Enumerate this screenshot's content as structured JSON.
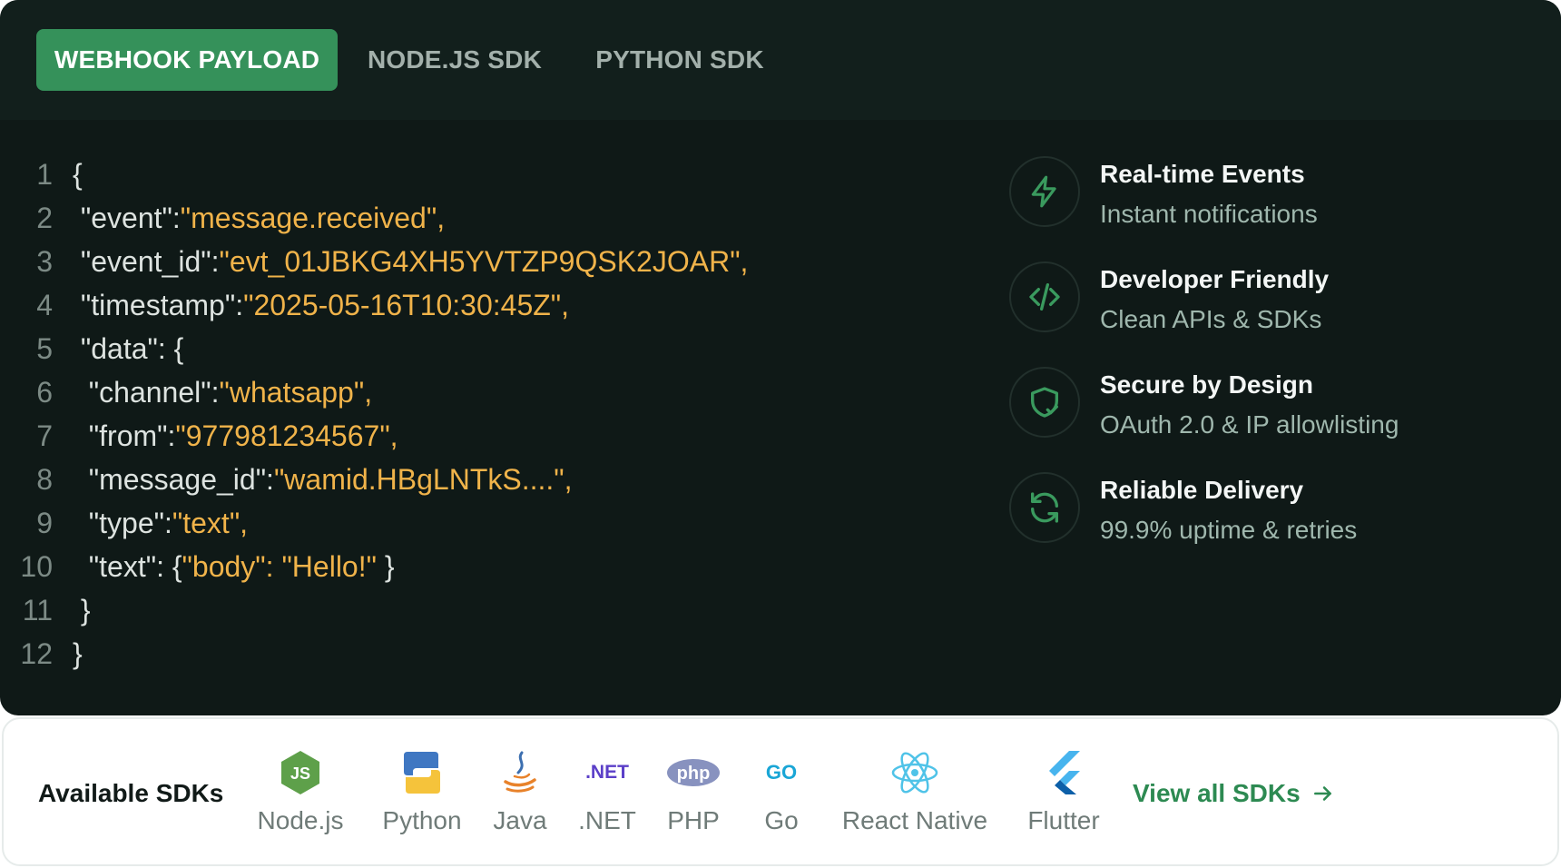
{
  "tabs": [
    {
      "label": "WEBHOOK PAYLOAD",
      "active": true
    },
    {
      "label": "NODE.JS SDK",
      "active": false
    },
    {
      "label": "PYTHON SDK",
      "active": false
    }
  ],
  "code_lines": [
    {
      "n": "1",
      "indent": "",
      "parts": [
        [
          "pun",
          "{"
        ]
      ]
    },
    {
      "n": "2",
      "indent": " ",
      "parts": [
        [
          "key",
          "\"event\":"
        ],
        [
          "str",
          "\"message.received\","
        ]
      ]
    },
    {
      "n": "3",
      "indent": " ",
      "parts": [
        [
          "key",
          "\"event_id\":"
        ],
        [
          "str",
          "\"evt_01JBKG4XH5YVTZP9QSK2JOAR\","
        ]
      ]
    },
    {
      "n": "4",
      "indent": " ",
      "parts": [
        [
          "key",
          "\"timestamp\":"
        ],
        [
          "str",
          "\"2025-05-16T10:30:45Z\","
        ]
      ]
    },
    {
      "n": "5",
      "indent": " ",
      "parts": [
        [
          "key",
          "\"data\": {"
        ]
      ]
    },
    {
      "n": "6",
      "indent": "  ",
      "parts": [
        [
          "key",
          "\"channel\":"
        ],
        [
          "str",
          "\"whatsapp\","
        ]
      ]
    },
    {
      "n": "7",
      "indent": "  ",
      "parts": [
        [
          "key",
          "\"from\":"
        ],
        [
          "str",
          "\"977981234567\","
        ]
      ]
    },
    {
      "n": "8",
      "indent": "  ",
      "parts": [
        [
          "key",
          "\"message_id\":"
        ],
        [
          "str",
          "\"wamid.HBgLNTkS....\","
        ]
      ]
    },
    {
      "n": "9",
      "indent": "  ",
      "parts": [
        [
          "key",
          "\"type\":"
        ],
        [
          "str",
          "\"text\","
        ]
      ]
    },
    {
      "n": "10",
      "indent": "  ",
      "parts": [
        [
          "key",
          "\"text\": {"
        ],
        [
          "str",
          "\"body\": \"Hello!\""
        ],
        [
          "pun",
          " }"
        ]
      ]
    },
    {
      "n": "11",
      "indent": " ",
      "parts": [
        [
          "pun",
          "}"
        ]
      ]
    },
    {
      "n": "12",
      "indent": "",
      "parts": [
        [
          "pun",
          "}"
        ]
      ]
    }
  ],
  "features": [
    {
      "icon": "lightning-icon",
      "title": "Real-time Events",
      "desc": "Instant notifications"
    },
    {
      "icon": "code-icon",
      "title": "Developer Friendly",
      "desc": "Clean APIs & SDKs"
    },
    {
      "icon": "shield-check-icon",
      "title": "Secure by Design",
      "desc": "OAuth 2.0 & IP allowlisting"
    },
    {
      "icon": "refresh-icon",
      "title": "Reliable Delivery",
      "desc": "99.9% uptime & retries"
    }
  ],
  "sdk_bar": {
    "heading": "Available SDKs",
    "view_all": "View all SDKs",
    "sdks": [
      {
        "label": "Node.js",
        "icon": "nodejs-logo-icon",
        "logo_text": "JS"
      },
      {
        "label": "Python",
        "icon": "python-logo-icon"
      },
      {
        "label": "Java",
        "icon": "java-logo-icon"
      },
      {
        "label": ".NET",
        "icon": "dotnet-logo-icon",
        "logo_text": ".NET"
      },
      {
        "label": "PHP",
        "icon": "php-logo-icon",
        "logo_text": "php"
      },
      {
        "label": "Go",
        "icon": "go-logo-icon",
        "logo_text": "GO"
      },
      {
        "label": "React Native",
        "icon": "react-logo-icon"
      },
      {
        "label": "Flutter",
        "icon": "flutter-logo-icon"
      }
    ]
  },
  "colors": {
    "accent": "#35915a",
    "panel_bg": "#0f1917",
    "string": "#f0b34a",
    "feature_icon": "#3a9a5e",
    "link": "#2d8a52"
  }
}
